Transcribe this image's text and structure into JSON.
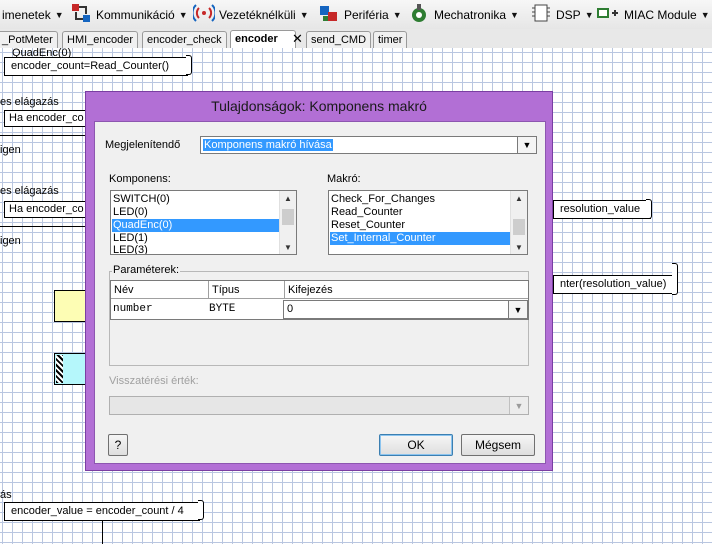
{
  "toolbar": {
    "items": [
      {
        "label": "imenetek"
      },
      {
        "label": "Kommunikáció"
      },
      {
        "label": "Vezetéknélküli"
      },
      {
        "label": "Periféria"
      },
      {
        "label": "Mechatronika"
      },
      {
        "label": "DSP"
      },
      {
        "label": "MIAC Module"
      }
    ]
  },
  "tabs": [
    {
      "label": "_PotMeter"
    },
    {
      "label": "HMI_encoder"
    },
    {
      "label": "encoder_check"
    },
    {
      "label": "encoder",
      "active": true
    },
    {
      "label": "send_CMD"
    },
    {
      "label": "timer"
    }
  ],
  "tab_close": "✕",
  "canvas": {
    "top_box_line1": "QuadEnc(0)",
    "top_box_line2": "encoder_count=Read_Counter()",
    "branch1": "es elágazás",
    "if1": "Ha encoder_co",
    "yes1": "igen",
    "branch2": "es elágazás",
    "if2": "Ha encoder_co",
    "yes2": "igen",
    "right1": "resolution_value",
    "right2": "nter(resolution_value)",
    "bottom_label": "ás",
    "bottom_box": "encoder_value = encoder_count / 4"
  },
  "dialog": {
    "title": "Tulajdonságok: Komponens makró",
    "display_label": "Megjelenítendő",
    "display_value": "Komponens makró hívása",
    "component_label": "Komponens:",
    "components": [
      "SWITCH(0)",
      "LED(0)",
      "QuadEnc(0)",
      "LED(1)",
      "LED(3)"
    ],
    "component_selected": 2,
    "macro_label": "Makró:",
    "macros": [
      "Check_For_Changes",
      "Read_Counter",
      "Reset_Counter",
      "Set_Internal_Counter"
    ],
    "macro_selected": 3,
    "params_label": "Paraméterek:",
    "params_headers": [
      "Név",
      "Típus",
      "Kifejezés"
    ],
    "params_rows": [
      {
        "name": "number",
        "type": "BYTE",
        "expr": "0"
      }
    ],
    "return_label": "Visszatérési érték:",
    "help_button": "?",
    "ok_button": "OK",
    "cancel_button": "Mégsem"
  },
  "colors": {
    "dialog_frame": "#b26fd5",
    "selection": "#3399ff",
    "grid": "#b9c6e0"
  }
}
